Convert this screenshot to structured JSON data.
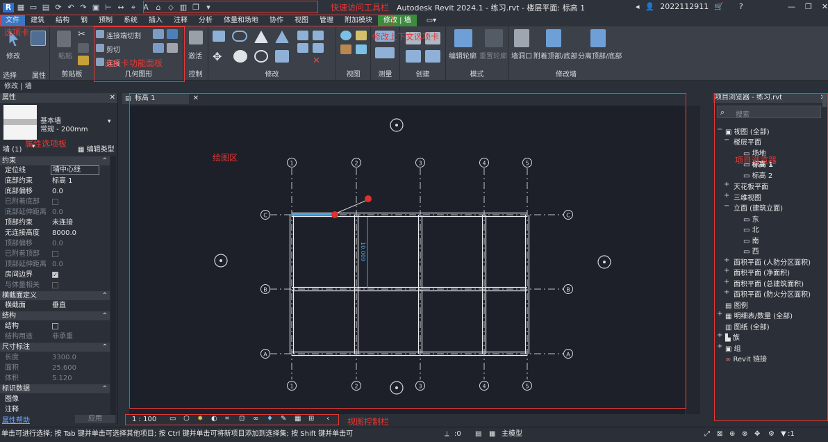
{
  "title_bar": {
    "app_title": "Autodesk Revit 2024.1 - 练习.rvt - 楼层平面: 标高 1",
    "username": "2022112911"
  },
  "menu_tabs": [
    "文件",
    "建筑",
    "结构",
    "钢",
    "预制",
    "系统",
    "插入",
    "注释",
    "分析",
    "体量和场地",
    "协作",
    "视图",
    "管理",
    "附加模块",
    "修改 | 墙"
  ],
  "ribbon": {
    "select_label": "选择",
    "modify_label": "修改",
    "properties_label": "属性",
    "paste_label": "粘贴",
    "clipboard_label": "剪贴板",
    "connect_cut_label": "连接端切割",
    "cut_label": "剪切",
    "join_label": "连接",
    "geometry_label": "几何图形",
    "activate_label": "激活",
    "control_label": "控制",
    "modify_panel_label": "修改",
    "view_label": "视图",
    "measure_label": "测量",
    "create_label": "创建",
    "edit_profile_label": "编辑轮廓",
    "reset_profile_label": "重置轮廓",
    "mode_label": "模式",
    "wall_opening_label": "墙洞口",
    "attach_label": "附着顶部/底部",
    "detach_label": "分离顶部/底部",
    "modify_wall_label": "修改墙"
  },
  "modify_bar": "修改 | 墙",
  "annotations": {
    "quick_access": "快速访问工具栏",
    "ribbon_panel": "选项卡",
    "func_panel": "选项卡功能面板",
    "context_tab": "修改上下文选项卡",
    "props_palette": "属性选项板",
    "drawing_area": "绘图区",
    "project_browser": "项目浏览器",
    "view_control": "视图控制栏"
  },
  "properties": {
    "header": "属性",
    "type_family": "基本墙",
    "type_name": "常规 - 200mm",
    "instance_count": "墙 (1)",
    "edit_type": "编辑类型",
    "sections": {
      "constraints": "约束",
      "cross_section": "横截面定义",
      "structure": "结构",
      "dimensions": "尺寸标注",
      "identity": "标识数据"
    },
    "rows": {
      "location_line": {
        "k": "定位线",
        "v": "墙中心线"
      },
      "base_constraint": {
        "k": "底部约束",
        "v": "标高 1"
      },
      "base_offset": {
        "k": "底部偏移",
        "v": "0.0"
      },
      "base_attached": {
        "k": "已附着底部",
        "v": ""
      },
      "base_ext": {
        "k": "底部延伸距离",
        "v": "0.0"
      },
      "top_constraint": {
        "k": "顶部约束",
        "v": "未连接"
      },
      "unconnected_height": {
        "k": "无连接高度",
        "v": "8000.0"
      },
      "top_offset": {
        "k": "顶部偏移",
        "v": "0.0"
      },
      "top_attached": {
        "k": "已附着顶部",
        "v": ""
      },
      "top_ext": {
        "k": "顶部延伸距离",
        "v": "0.0"
      },
      "room_bounding": {
        "k": "房间边界",
        "v": ""
      },
      "mass_related": {
        "k": "与体量相关",
        "v": ""
      },
      "cross_face": {
        "k": "横截面",
        "v": "垂直"
      },
      "structural": {
        "k": "结构",
        "v": ""
      },
      "structural_usage": {
        "k": "结构用途",
        "v": "非承重"
      },
      "length": {
        "k": "长度",
        "v": "3300.0"
      },
      "area": {
        "k": "面积",
        "v": "25.600"
      },
      "volume": {
        "k": "体积",
        "v": "5.120"
      },
      "image": {
        "k": "图像",
        "v": ""
      },
      "comments": {
        "k": "注释",
        "v": ""
      }
    },
    "help": "属性帮助",
    "apply": "应用"
  },
  "view_tab": "标高 1",
  "grid": {
    "numbers": [
      "1",
      "2",
      "3",
      "4",
      "5"
    ],
    "letters": [
      "C",
      "B",
      "A"
    ]
  },
  "dimension_text": "10.009",
  "view_bar": {
    "scale": "1 : 100"
  },
  "browser": {
    "title": "项目浏览器 - 练习.rvt",
    "search_placeholder": "搜索",
    "nodes": {
      "views": "视图 (全部)",
      "floor_plans": "楼层平面",
      "site": "场地",
      "level1": "标高 1",
      "level2": "标高 2",
      "ceiling": "天花板平面",
      "view3d": "三维视图",
      "elevations": "立面 (建筑立面)",
      "east": "东",
      "north": "北",
      "south": "南",
      "west": "西",
      "area_civil": "面积平面 (人防分区面积)",
      "area_net": "面积平面 (净面积)",
      "area_gross": "面积平面 (总建筑面积)",
      "area_fire": "面积平面 (防火分区面积)",
      "legends": "图例",
      "schedules": "明细表/数量 (全部)",
      "sheets": "图纸 (全部)",
      "families": "族",
      "groups": "组",
      "links": "Revit 链接"
    }
  },
  "status": {
    "text": "单击可进行选择; 按 Tab 键并单击可选择其他项目; 按 Ctrl 键并单击可将新项目添加到选择集; 按 Shift 键并单击可",
    "count": ":0",
    "model": "主模型",
    "filter": ":1"
  }
}
